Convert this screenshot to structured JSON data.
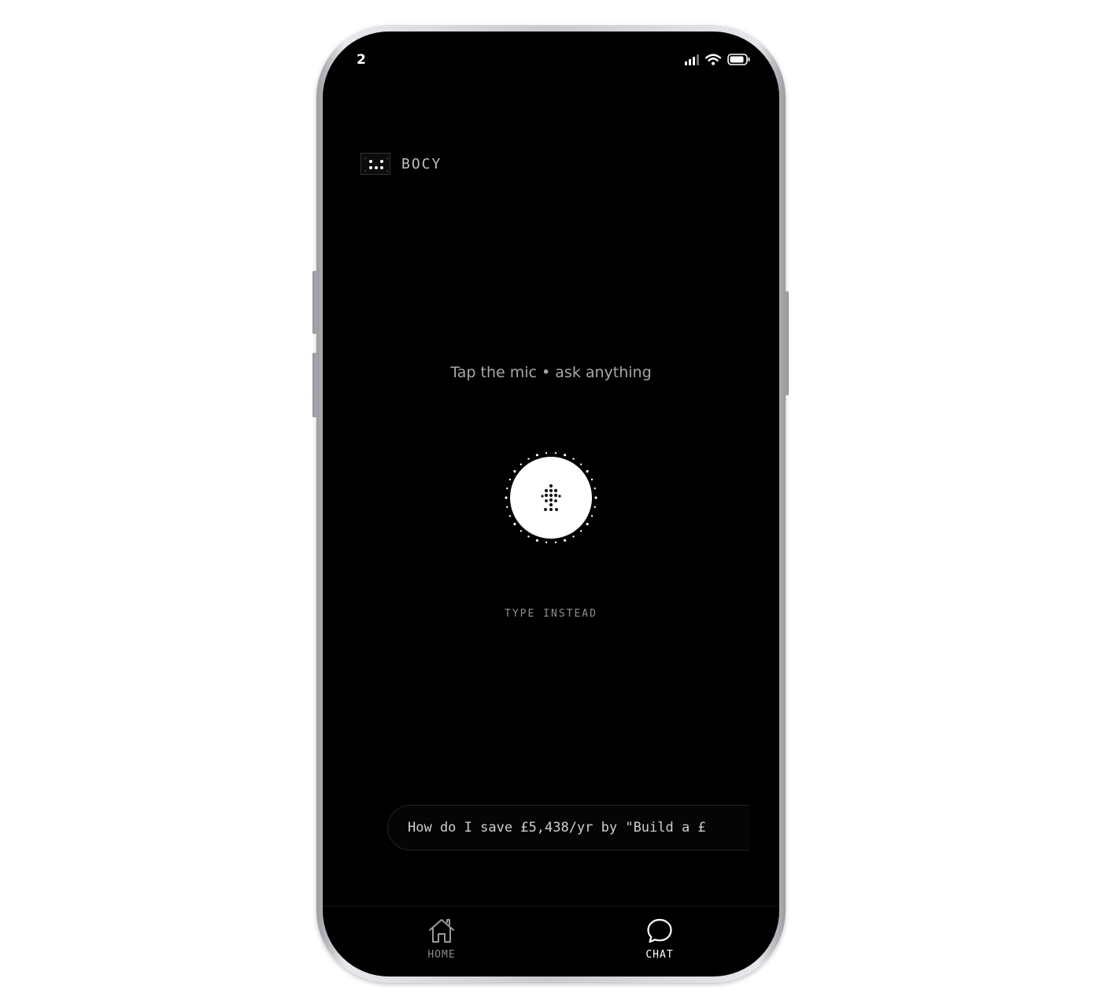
{
  "status_bar": {
    "time": "2"
  },
  "brand": {
    "name": "BOCY"
  },
  "prompt": {
    "text": "Tap the mic • ask anything"
  },
  "mic": {
    "icon": "mic-icon",
    "state": "idle"
  },
  "type_instead": {
    "label": "TYPE INSTEAD"
  },
  "ticker": {
    "text": "How do I save £5,438/yr by \"Build a £"
  },
  "nav": {
    "items": [
      {
        "label": "HOME",
        "icon": "home-icon",
        "active": false
      },
      {
        "label": "CHAT",
        "icon": "chat-bubble-icon",
        "active": true
      }
    ]
  },
  "colors": {
    "screen_bg": "#000000",
    "accent": "#ffffff",
    "muted_text": "#a8a8a8"
  }
}
